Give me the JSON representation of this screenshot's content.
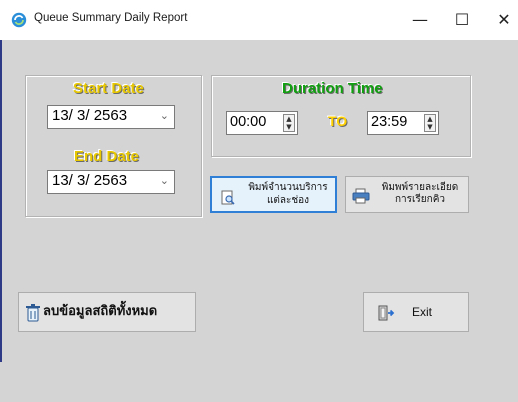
{
  "window": {
    "title": "Queue Summary Daily Report",
    "minimize_glyph": "—",
    "maximize_glyph": "☐",
    "close_glyph": "✕",
    "accent": "#2f7fd6"
  },
  "dates": {
    "start_label": "Start Date",
    "start_value": "13/ 3/ 2563",
    "end_label": "End Date",
    "end_value": "13/ 3/ 2563",
    "dropdown_glyph": "⌄"
  },
  "duration": {
    "label": "Duration Time",
    "from_value": "00:00",
    "to_label": "TO",
    "to_value": "23:59",
    "spin_up": "▲",
    "spin_down": "▼"
  },
  "buttons": {
    "print_per_channel": [
      "พิมพ์จำนวนบริการ",
      "แต่ละช่อง"
    ],
    "print_call_detail": [
      "พิมพพ์รายละเอียด",
      "การเรียกคิว"
    ],
    "clear_all": "ลบข้อมูลสถิติทั้งหมด",
    "exit": "Exit"
  },
  "icons": {
    "app": "refresh-circle-icon",
    "print_preview": "print-preview-icon",
    "printer": "printer-icon",
    "trash": "trash-icon",
    "exit_door": "exit-door-icon"
  }
}
